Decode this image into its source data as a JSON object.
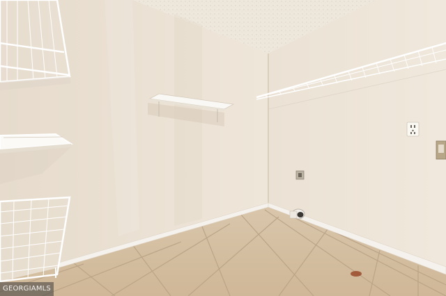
{
  "watermark": {
    "text": "GEORGIAMLS"
  },
  "colors": {
    "left_wall": "#ebe1d4",
    "right_wall": "#ece3d6",
    "ceiling": "#efe9e0",
    "floor_tile": "#d8c4a8",
    "grout": "#bfa98c",
    "baseboard": "#f4f1ec",
    "wire_shelf": "#ffffff"
  },
  "icons": [
    "power-outlet-icon",
    "dryer-vent-icon",
    "dryer-outlet-box-icon"
  ]
}
